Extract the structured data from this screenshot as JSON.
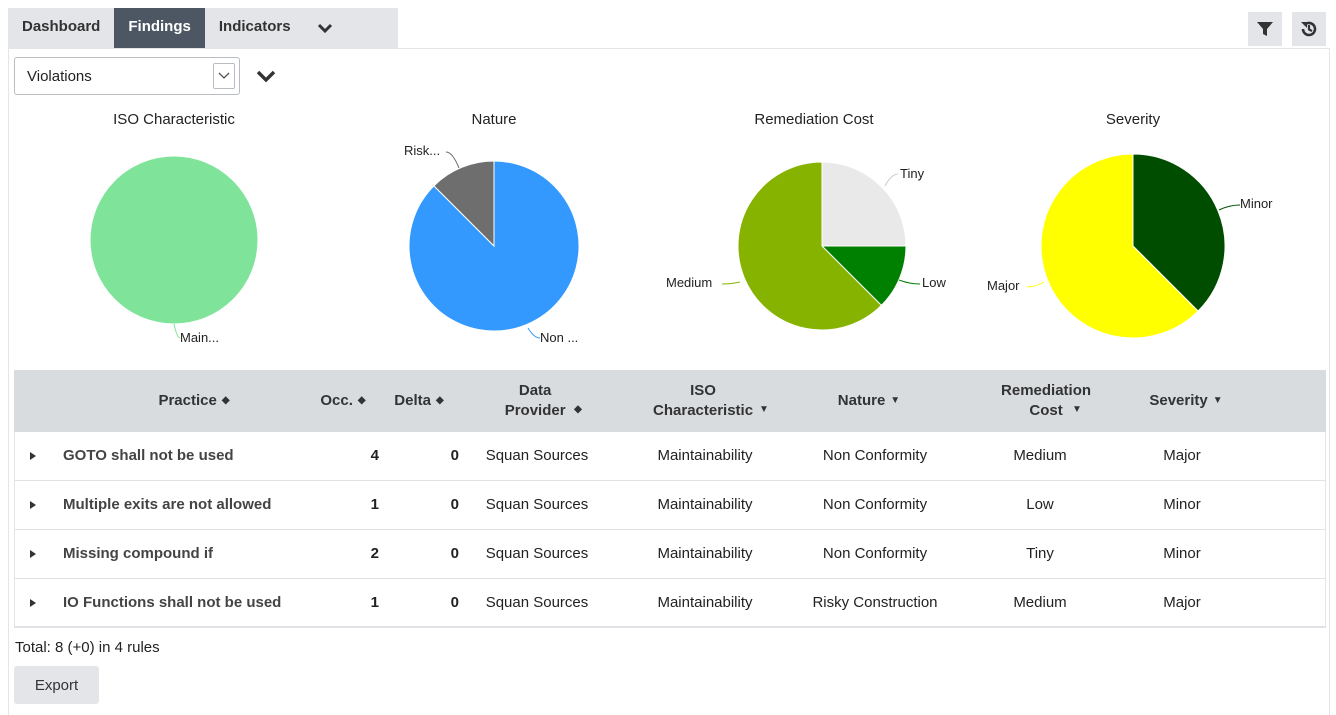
{
  "tabs": [
    {
      "label": "Dashboard",
      "active": false
    },
    {
      "label": "Findings",
      "active": true
    },
    {
      "label": "Indicators",
      "active": false
    }
  ],
  "toolbar": {
    "filter_icon": "filter-icon",
    "reset_icon": "history-icon"
  },
  "selector": {
    "value": "Violations"
  },
  "charts": [
    {
      "title": "ISO Characteristic",
      "slices": [
        {
          "label": "Main...",
          "value": 8,
          "color": "#7fe49a"
        }
      ]
    },
    {
      "title": "Nature",
      "slices": [
        {
          "label": "Non ...",
          "value": 7,
          "color": "#3399ff"
        },
        {
          "label": "Risk...",
          "value": 1,
          "color": "#6e6e6e"
        }
      ]
    },
    {
      "title": "Remediation Cost",
      "slices": [
        {
          "label": "Tiny",
          "value": 2,
          "color": "#e9e9e9"
        },
        {
          "label": "Low",
          "value": 1,
          "color": "#008000"
        },
        {
          "label": "Medium",
          "value": 5,
          "color": "#86b300"
        }
      ]
    },
    {
      "title": "Severity",
      "slices": [
        {
          "label": "Minor",
          "value": 3,
          "color": "#004d00"
        },
        {
          "label": "Major",
          "value": 5,
          "color": "#ffff00"
        }
      ]
    }
  ],
  "table": {
    "headers": {
      "practice": "Practice",
      "occ": "Occ.",
      "delta": "Delta",
      "provider": "Data Provider",
      "iso": "ISO Characteristic",
      "nature": "Nature",
      "cost": "Remediation Cost",
      "severity": "Severity"
    },
    "rows": [
      {
        "practice": "GOTO shall not be used",
        "occ": "4",
        "delta": "0",
        "provider": "Squan Sources",
        "iso": "Maintainability",
        "nature": "Non Conformity",
        "cost": "Medium",
        "severity": "Major"
      },
      {
        "practice": "Multiple exits are not allowed",
        "occ": "1",
        "delta": "0",
        "provider": "Squan Sources",
        "iso": "Maintainability",
        "nature": "Non Conformity",
        "cost": "Low",
        "severity": "Minor"
      },
      {
        "practice": "Missing compound if",
        "occ": "2",
        "delta": "0",
        "provider": "Squan Sources",
        "iso": "Maintainability",
        "nature": "Non Conformity",
        "cost": "Tiny",
        "severity": "Minor"
      },
      {
        "practice": "IO Functions shall not be used",
        "occ": "1",
        "delta": "0",
        "provider": "Squan Sources",
        "iso": "Maintainability",
        "nature": "Risky Construction",
        "cost": "Medium",
        "severity": "Major"
      }
    ]
  },
  "footer": {
    "total": "Total: 8 (+0) in 4 rules",
    "export_label": "Export"
  }
}
